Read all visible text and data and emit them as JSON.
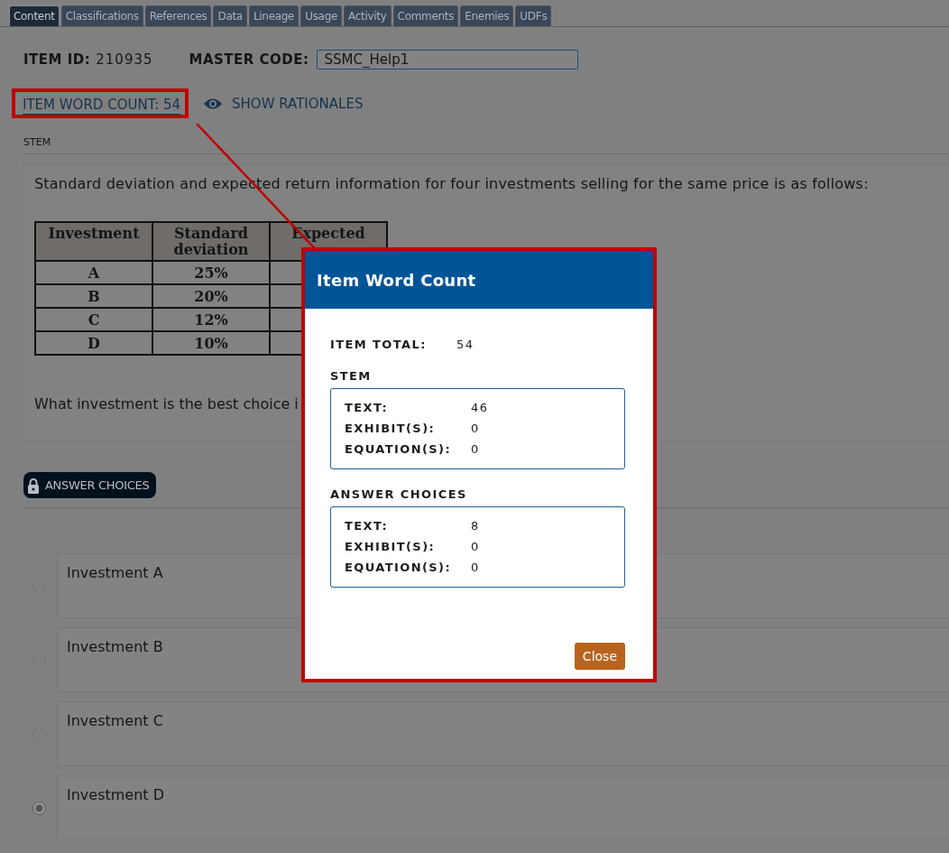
{
  "tabs": [
    {
      "label": "Content",
      "selected": true
    },
    {
      "label": "Classifications",
      "selected": false
    },
    {
      "label": "References",
      "selected": false
    },
    {
      "label": "Data",
      "selected": false
    },
    {
      "label": "Lineage",
      "selected": false
    },
    {
      "label": "Usage",
      "selected": false
    },
    {
      "label": "Activity",
      "selected": false
    },
    {
      "label": "Comments",
      "selected": false
    },
    {
      "label": "Enemies",
      "selected": false
    },
    {
      "label": "UDFs",
      "selected": false
    }
  ],
  "item_id": {
    "label": "ITEM ID:",
    "value": "210935"
  },
  "master_code": {
    "label": "MASTER CODE:",
    "value": "SSMC_Help1"
  },
  "word_count_link": "ITEM WORD COUNT: 54",
  "show_rationales": "SHOW RATIONALES",
  "stem": {
    "label": "STEM",
    "intro": "Standard deviation and expected return information for four investments selling for the same price is as follows:",
    "table": {
      "columns": [
        "Investment",
        "Standard deviation",
        "Expected"
      ],
      "rows": [
        [
          "A",
          "25%"
        ],
        [
          "B",
          "20%"
        ],
        [
          "C",
          "12%"
        ],
        [
          "D",
          "10%"
        ]
      ]
    },
    "question": "What investment is the best choice i"
  },
  "answer_choices": {
    "label": "ANSWER CHOICES",
    "choices": [
      {
        "text": "Investment A",
        "selected": false
      },
      {
        "text": "Investment B",
        "selected": false
      },
      {
        "text": "Investment C",
        "selected": false
      },
      {
        "text": "Investment D",
        "selected": true
      }
    ]
  },
  "dialog": {
    "title": "Item Word Count",
    "total_label": "ITEM TOTAL:",
    "total_value": "54",
    "sections": [
      {
        "title": "STEM",
        "rows": [
          {
            "label": "TEXT:",
            "value": "46"
          },
          {
            "label": "EXHIBIT(S):",
            "value": "0"
          },
          {
            "label": "EQUATION(S):",
            "value": "0"
          }
        ]
      },
      {
        "title": "ANSWER CHOICES",
        "rows": [
          {
            "label": "TEXT:",
            "value": "8"
          },
          {
            "label": "EXHIBIT(S):",
            "value": "0"
          },
          {
            "label": "EQUATION(S):",
            "value": "0"
          }
        ]
      }
    ],
    "close": "Close"
  }
}
